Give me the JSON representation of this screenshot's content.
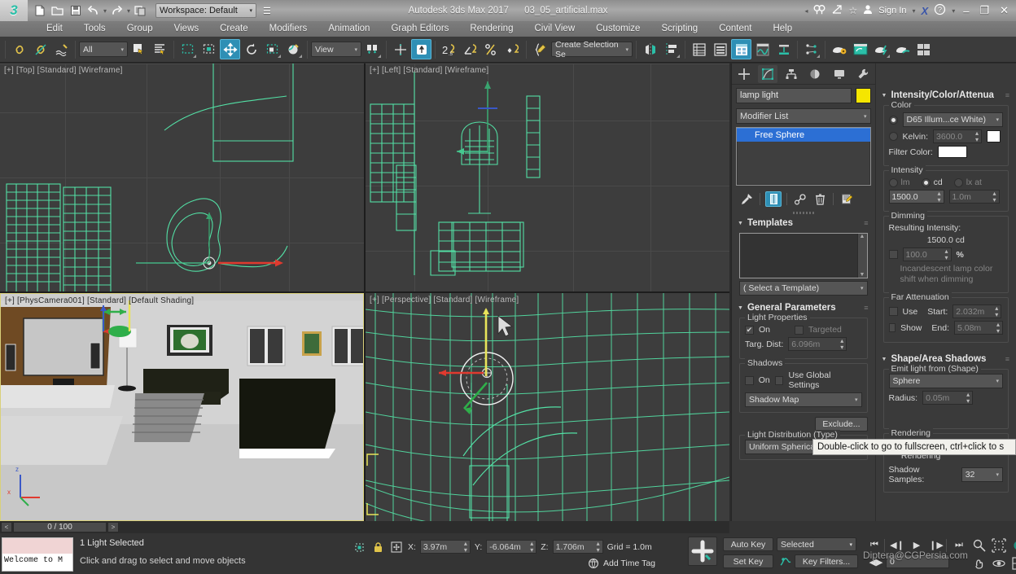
{
  "titlebar": {
    "logo": "3",
    "quick_access": [
      "new-icon",
      "open-icon",
      "save-icon",
      "undo-icon",
      "redo-icon",
      "project-folder-icon"
    ],
    "workspace_label": "Workspace: Default",
    "app_title": "Autodesk 3ds Max 2017",
    "file_name": "03_05_artificial.max",
    "signin_label": "Sign In",
    "x_badge": "X",
    "help_icon": "?",
    "minimize": "–",
    "restore": "❐",
    "close": "✕"
  },
  "menubar": {
    "items": [
      "Edit",
      "Tools",
      "Group",
      "Views",
      "Create",
      "Modifiers",
      "Animation",
      "Graph Editors",
      "Rendering",
      "Civil View",
      "Customize",
      "Scripting",
      "Content",
      "Help"
    ]
  },
  "toolbar": {
    "selection_filter": "All",
    "reference_coord": "View",
    "named_selection_sets": "Create Selection Se",
    "angle_snap_label": "2",
    "percent_snap_label": "%",
    "snap_toggle_label": "2.5"
  },
  "viewports": [
    {
      "name": "viewport-top",
      "label": "[+] [Top] [Standard] [Wireframe]",
      "active": false
    },
    {
      "name": "viewport-left",
      "label": "[+] [Left] [Standard] [Wireframe]",
      "active": false
    },
    {
      "name": "viewport-camera",
      "label": "[+] [PhysCamera001] [Standard] [Default Shading]",
      "active": true
    },
    {
      "name": "viewport-perspective",
      "label": "[+] [Perspective] [Standard] [Wireframe]",
      "active": false
    }
  ],
  "command_panel": {
    "tabs": [
      "create-tab-icon",
      "modify-tab-icon",
      "hierarchy-tab-icon",
      "motion-tab-icon",
      "display-tab-icon",
      "utilities-tab-icon"
    ],
    "object_name": "lamp light",
    "object_color": "#f5e600",
    "modifier_list_label": "Modifier List",
    "modifier_stack": [
      "Free Sphere"
    ],
    "templates": {
      "title": "Templates",
      "select_label": "( Select a Template)"
    },
    "general_parameters": {
      "title": "General Parameters",
      "light_properties_label": "Light Properties",
      "on_label": "On",
      "on_checked": true,
      "targeted_label": "Targeted",
      "targeted_checked": false,
      "targ_dist_label": "Targ. Dist:",
      "targ_dist_value": "6.096m",
      "shadows_label": "Shadows",
      "shadows_on_label": "On",
      "shadows_on_checked": false,
      "use_global_label": "Use Global Settings",
      "use_global_checked": false,
      "shadow_type": "Shadow Map",
      "exclude_label": "Exclude...",
      "light_distribution_label": "Light Distribution (Type)",
      "light_distribution_value": "Uniform Spherical"
    },
    "intensity_color": {
      "title": "Intensity/Color/Attenua",
      "color_label": "Color",
      "preset_value": "D65 Illum...ce White)",
      "preset_selected": true,
      "kelvin_label": "Kelvin:",
      "kelvin_value": "3600.0",
      "kelvin_selected": false,
      "filter_color_label": "Filter Color:",
      "filter_color": "#ffffff",
      "intensity_label": "Intensity",
      "unit_lm": "lm",
      "unit_cd": "cd",
      "unit_lx": "lx at",
      "unit_selected": "cd",
      "intensity_value": "1500.0",
      "lx_distance": "1.0m",
      "dimming_label": "Dimming",
      "resulting_intensity_label": "Resulting Intensity:",
      "resulting_intensity_value": "1500.0 cd",
      "dim_percent": "100.0",
      "percent_sign": "%",
      "incandescent_label": "Incandescent lamp color shift when dimming"
    },
    "far_attenuation": {
      "title": "Far Attenuation",
      "use_label": "Use",
      "show_label": "Show",
      "start_label": "Start:",
      "start_value": "2.032m",
      "end_label": "End:",
      "end_value": "5.08m"
    },
    "shape_area_shadows": {
      "title": "Shape/Area Shadows",
      "emit_label": "Emit light from (Shape)",
      "shape_value": "Sphere",
      "radius_label": "Radius:",
      "radius_value": "0.05m",
      "rendering_label": "Rendering",
      "light_shape_visible_label": "Light Shape Visible in Rendering",
      "shadow_samples_label": "Shadow Samples:",
      "shadow_samples_value": "32"
    }
  },
  "tooltip": {
    "text": "Double-click to go to fullscreen, ctrl+click to s"
  },
  "timeline": {
    "prev_label": "<",
    "next_label": ">",
    "frame_label": "0 / 100"
  },
  "statusbar": {
    "max_listener": "Welcome to M",
    "status_text": "1 Light Selected",
    "prompt_text": "Click and drag to select and move objects",
    "x_label": "X:",
    "x_value": "3.97m",
    "y_label": "Y:",
    "y_value": "-6.064m",
    "z_label": "Z:",
    "z_value": "1.706m",
    "grid_label": "Grid = 1.0m",
    "add_time_tag": "Add Time Tag"
  },
  "animation": {
    "auto_key": "Auto Key",
    "set_key": "Set Key",
    "selection_level": "Selected",
    "key_filters": "Key Filters...",
    "current_frame": "0"
  },
  "watermark": "Diptera@CGPersia.com",
  "colors": {
    "accent": "#2e8fb5",
    "wire_green": "#53e0a5",
    "selection_blue": "#2c6fd4",
    "active_viewport": "#d9d07a",
    "object_yellow": "#f5e600"
  }
}
